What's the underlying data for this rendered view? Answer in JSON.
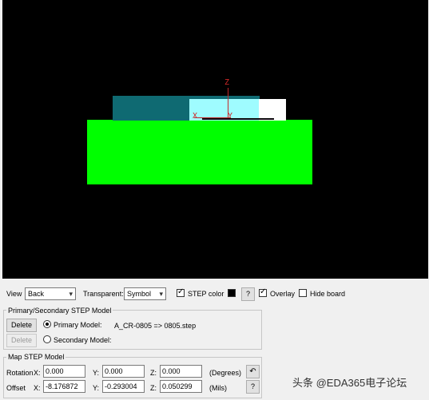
{
  "viewport": {
    "background": "#000000",
    "shapes": {
      "pcb_color": "#00ff00",
      "body_color": "#0f6a72",
      "highlight_color": "#9ffcff",
      "pad_color": "#ffffff",
      "axis_color": "#c0282a"
    },
    "axis_z_label": "Z",
    "axis_x_left_label": "X",
    "axis_x_right_label": "Y"
  },
  "toolbar": {
    "view_label": "View",
    "view_value": "Back",
    "transparent_label": "Transparent:",
    "transparent_value": "Symbol",
    "step_color_label": "STEP color",
    "step_color_checked": true,
    "help_label": "?",
    "overlay_label": "Overlay",
    "overlay_checked": true,
    "hide_board_label": "Hide board",
    "hide_board_checked": false
  },
  "model_group": {
    "title": "Primary/Secondary STEP Model",
    "delete_label": "Delete",
    "primary_label": "Primary Model:",
    "primary_value": "A_CR-0805 => 0805.step",
    "secondary_label": "Secondary Model:"
  },
  "map_group": {
    "title": "Map STEP Model",
    "rotation_label": "Rotation",
    "offset_label": "Offset",
    "x_label": "X:",
    "y_label": "Y:",
    "z_label": "Z:",
    "rotation_x": "0.000",
    "rotation_y": "0.000",
    "rotation_z": "0.000",
    "offset_x": "-8.176872",
    "offset_y": "-0.293004",
    "offset_z": "0.050299",
    "degrees_label": "(Degrees)",
    "mils_label": "(Mils)",
    "reset_icon": "undo-arrow-icon",
    "help_label": "?"
  },
  "watermark": "头条 @EDA365电子论坛"
}
